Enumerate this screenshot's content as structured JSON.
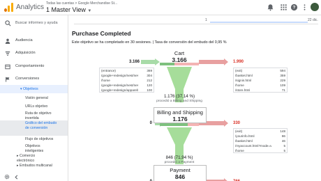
{
  "header": {
    "app_title": "Analytics",
    "breadcrumb": "Todas las cuentas > Google Merchandise St...",
    "view_name": "1 Master View",
    "colors": {
      "brand_orange": "#f9ab00",
      "accent_blue": "#1a73e8"
    }
  },
  "sidebar": {
    "search_placeholder": "Buscar informes y ayuda",
    "sections": [
      {
        "label": "Audiencia",
        "icon": "person-icon"
      },
      {
        "label": "Adquisición",
        "icon": "acquisition-icon"
      },
      {
        "label": "Comportamiento",
        "icon": "behavior-icon"
      },
      {
        "label": "Conversiones",
        "icon": "flag-icon"
      }
    ],
    "objetivos_label": "Objetivos",
    "sub_items": [
      "Visión general",
      "URLs objetivo",
      "Ruta de objetivo invertida",
      "Gráfico del embudo de conversión",
      "Flujo de objetivos",
      "Objetivos inteligentes"
    ],
    "ecommerce_label": "Comercio electrónico",
    "multichannel_label": "Embudos multicanal"
  },
  "timeline": {
    "ticks": [
      "1",
      "22 dic."
    ]
  },
  "report": {
    "title": "Purchase Completed",
    "summary": "Este objetivo se ha completado en 30 sesiones. | Tasa de conversión del embudo del 0,95 %"
  },
  "stages": [
    {
      "name": "Cart",
      "value": "3.166",
      "in": "3.166",
      "out": "1.990",
      "entries": [
        {
          "path": "(entrance)",
          "count": "369"
        },
        {
          "path": "/google+redesign/nest/nest-...",
          "count": "304"
        },
        {
          "path": "/home",
          "count": "212"
        },
        {
          "path": "/google+redesign/nest/nest-...",
          "count": "120"
        },
        {
          "path": "/google+redesign/apparel/m...",
          "count": "100"
        }
      ],
      "exits": [
        {
          "path": "(exit)",
          "count": "594"
        },
        {
          "path": "/basket.html",
          "count": "359"
        },
        {
          "path": "/signin.html",
          "count": "229"
        },
        {
          "path": "/home",
          "count": "109"
        },
        {
          "path": "/store.html",
          "count": "71"
        }
      ],
      "flow_value": "1.176 (37,14 %)",
      "flow_label": "procedió a Billing and Shipping"
    },
    {
      "name": "Billing and Shipping",
      "value": "1.176",
      "in": "0",
      "out": "330",
      "entries": [],
      "exits": [
        {
          "path": "(exit)",
          "count": "148"
        },
        {
          "path": "/yourinfo.html",
          "count": "86"
        },
        {
          "path": "/basket.html",
          "count": "46"
        },
        {
          "path": "/myaccount.html?mode=vie...",
          "count": "5"
        },
        {
          "path": "/home",
          "count": "5"
        }
      ],
      "flow_value": "846 (71,94 %)",
      "flow_label": "procedió a Payment"
    },
    {
      "name": "Payment",
      "value": "846",
      "in": "0",
      "out": "766",
      "entries": [],
      "exits": []
    }
  ]
}
